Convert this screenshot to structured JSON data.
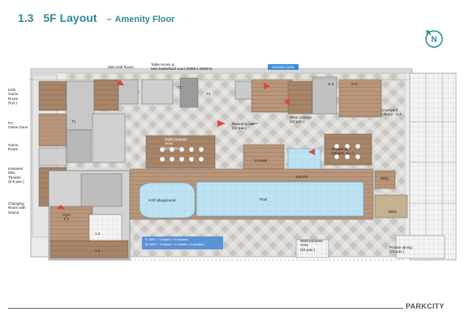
{
  "header": {
    "section_number": "1.3",
    "title": "5F Layout",
    "subtitle": "Amenity Floor"
  },
  "compass": {
    "letter": "N"
  },
  "footer": {
    "logo": "PARKCITY"
  },
  "labels": {
    "mini_golf": "Mini-Golf Room",
    "table_tennis": "Table tennis &\nMini-basketball court (6859 x 8080m)",
    "cinema": "Cinema room",
    "kids_game": "Kids\nGame\nRoom\n(Kyr.)",
    "pc_game": "PC\nGame Zone",
    "game_room": "Game\nRoom",
    "karaoke": "Karaoke/\nMini\nTheatre\n(8-9 pax.)",
    "changing": "Changing\nRoom with\nSauna",
    "gym": "Gym\n0.0",
    "resident_club": "Resident club\n(42 pax.)",
    "wine_lounge": "Wine Lounge\n(12 pax.)",
    "courtyard": "Courtyard\nLibrary - 2.4",
    "multi_purpose_1": "Multi-purpose\nArea\n(110 pax.)",
    "lounge": "Lounge",
    "jacuzzi": "Jacuzzi",
    "private_dining_1": "Private di...\n(30 pax. m...)",
    "bbq_1": "BBQ",
    "bbq_2": "BBQ",
    "h2o": "H2O playground",
    "pool": "Pool",
    "multi_purpose_2": "Multi-purpose\nArea\n(84 pax.)",
    "private_dining_2": "Private dining\n(72 pax.)",
    "legend": "F: 3WC + 3 basins + 6 showers\nM: 3WC + 2 basins + 2 urinals + 6 showers",
    "room_1_2a": "1.2",
    "room_1_2b": "1.2",
    "tag_t1": "T1",
    "tag_t2": "T2",
    "tag_t3": "T3",
    "tag_g": "G.0",
    "tag_gf": "G.F"
  },
  "colors": {
    "title": "#2d8a96",
    "pool_water": "#bfe3f2",
    "legend_bg": "#5c93d6",
    "cinema_badge": "#3a8fd6",
    "wood": "#a88468",
    "tile": "#d8d6d2",
    "building": "#bdbdbd",
    "accent_red": "#e0463c"
  }
}
